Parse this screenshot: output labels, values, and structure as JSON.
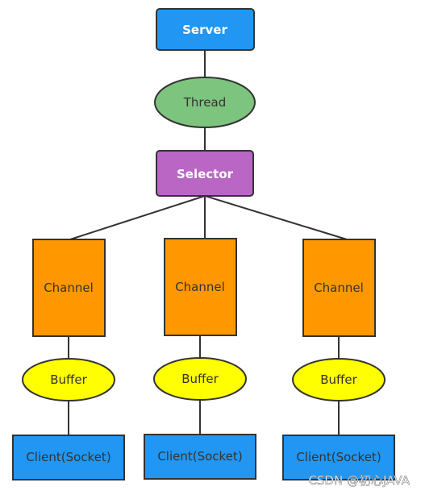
{
  "colors": {
    "server": "#2196F3",
    "thread": "#7DC47F",
    "selector": "#B966C4",
    "channel": "#FF9800",
    "buffer": "#FFFF00",
    "client": "#2196F3",
    "stroke": "#333333"
  },
  "nodes": {
    "server": "Server",
    "thread": "Thread",
    "selector": "Selector",
    "channels": [
      "Channel",
      "Channel",
      "Channel"
    ],
    "buffers": [
      "Buffer",
      "Buffer",
      "Buffer"
    ],
    "clients": [
      "Client(Socket)",
      "Client(Socket)",
      "Client(Socket)"
    ]
  },
  "watermark": "CSDN @初心JAVA"
}
